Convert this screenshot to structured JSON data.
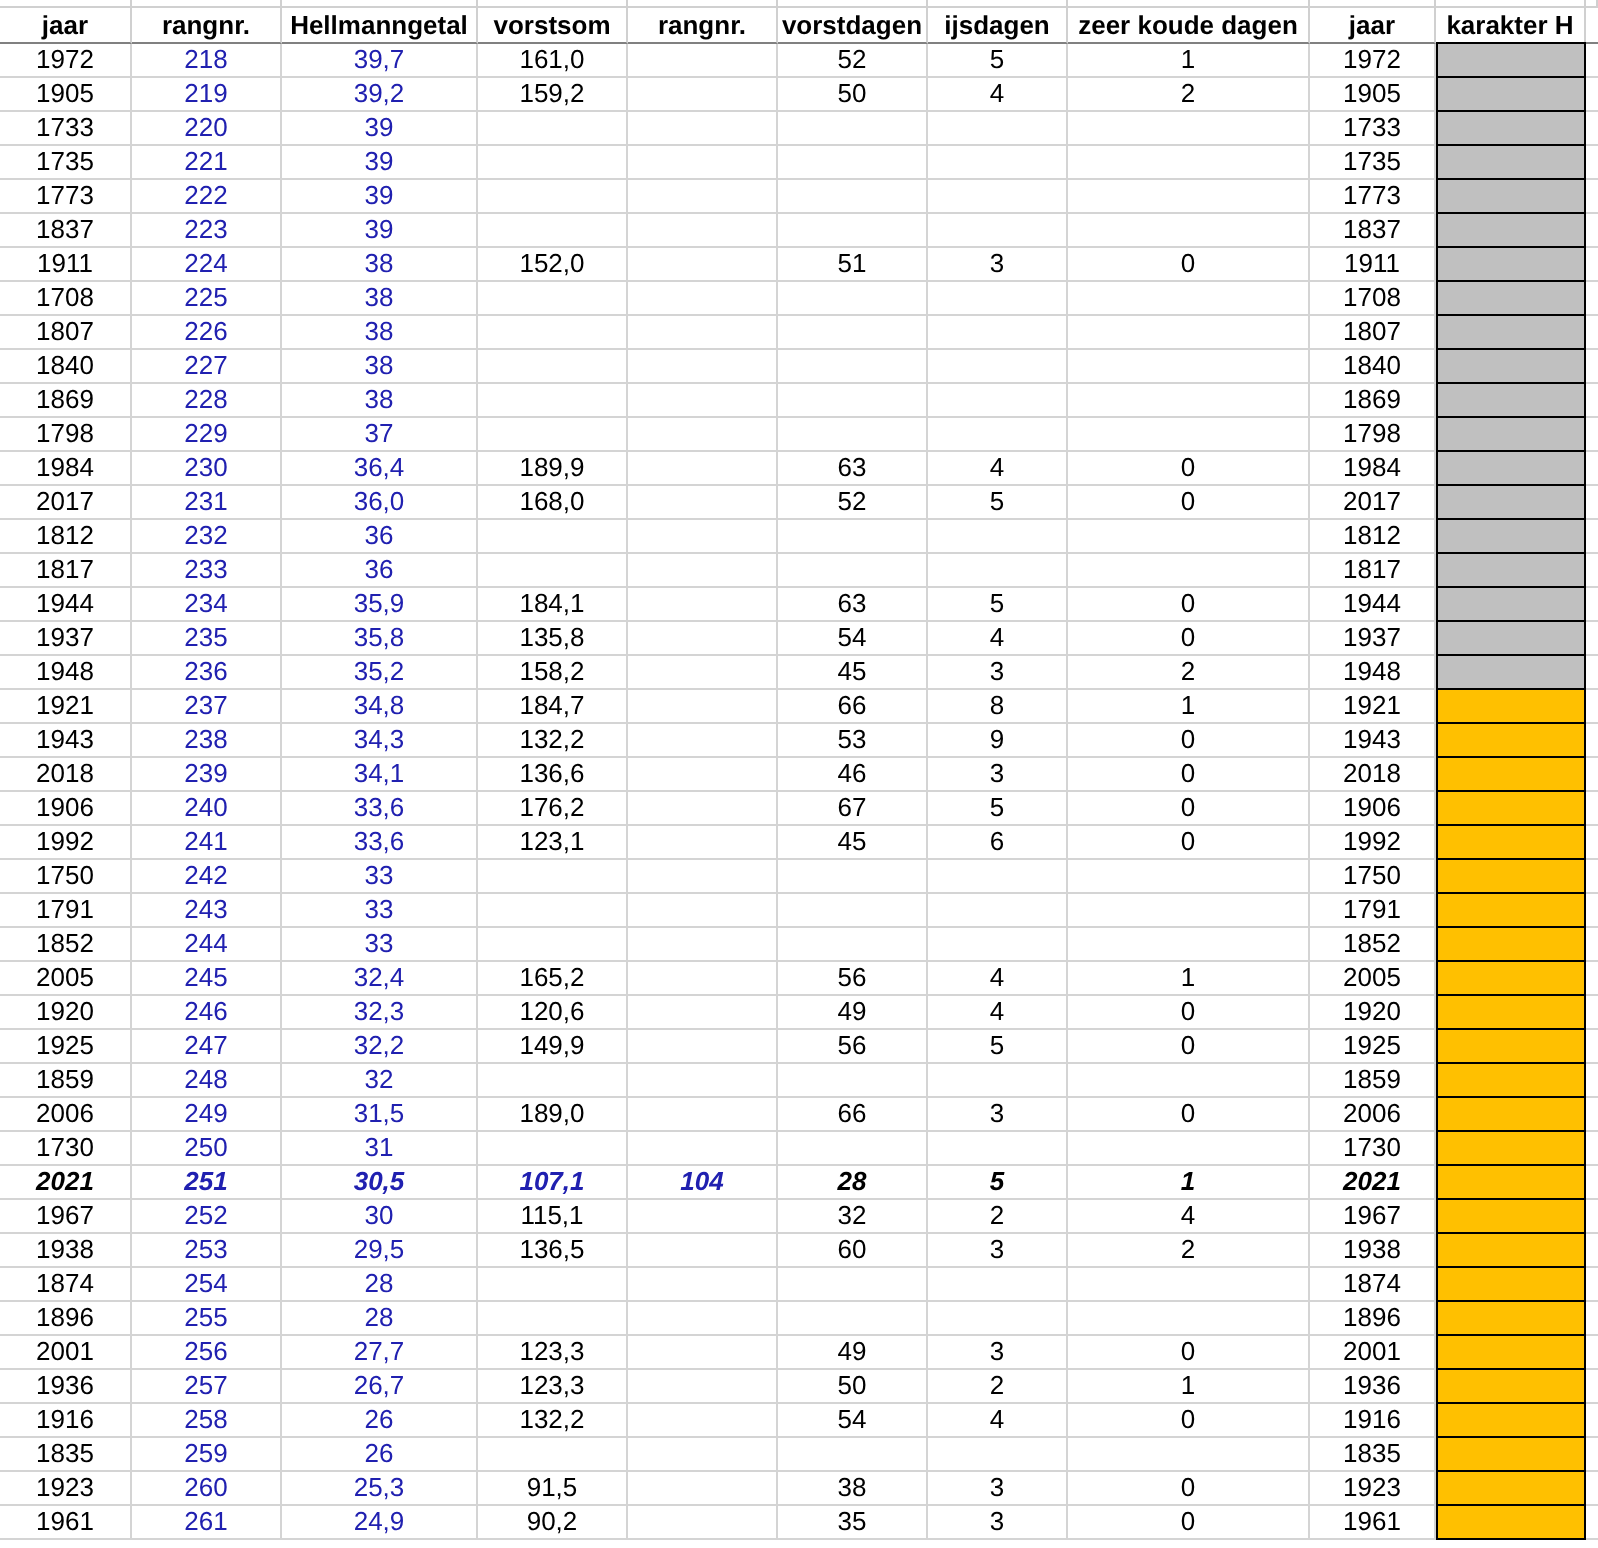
{
  "table": {
    "columns": [
      "jaar",
      "rangnr.",
      "Hellmanngetal",
      "vorstsom",
      "rangnr.",
      "vorstdagen",
      "ijsdagen",
      "zeer koude dagen",
      "jaar",
      "karakter H"
    ],
    "rows": [
      {
        "jaar": "1972",
        "rangnr": "218",
        "hellmann": "39,7",
        "vorstsom": "161,0",
        "vorstdagen": "52",
        "ijsdagen": "5",
        "zeer_koude_dagen": "1",
        "jaar_2": "1972",
        "color": "#c0c0c0",
        "highlighted": false
      },
      {
        "jaar": "1905",
        "rangnr": "219",
        "hellmann": "39,2",
        "vorstsom": "159,2",
        "vorstdagen": "50",
        "ijsdagen": "4",
        "zeer_koude_dagen": "2",
        "jaar_2": "1905",
        "color": "#c0c0c0",
        "highlighted": false
      },
      {
        "jaar": "1733",
        "rangnr": "220",
        "hellmann": "39",
        "jaar_2": "1733",
        "color": "#c0c0c0",
        "highlighted": false
      },
      {
        "jaar": "1735",
        "rangnr": "221",
        "hellmann": "39",
        "jaar_2": "1735",
        "color": "#c0c0c0",
        "highlighted": false
      },
      {
        "jaar": "1773",
        "rangnr": "222",
        "hellmann": "39",
        "jaar_2": "1773",
        "color": "#c0c0c0",
        "highlighted": false
      },
      {
        "jaar": "1837",
        "rangnr": "223",
        "hellmann": "39",
        "jaar_2": "1837",
        "color": "#c0c0c0",
        "highlighted": false
      },
      {
        "jaar": "1911",
        "rangnr": "224",
        "hellmann": "38",
        "vorstsom": "152,0",
        "vorstdagen": "51",
        "ijsdagen": "3",
        "zeer_koude_dagen": "0",
        "jaar_2": "1911",
        "color": "#c0c0c0",
        "highlighted": false
      },
      {
        "jaar": "1708",
        "rangnr": "225",
        "hellmann": "38",
        "jaar_2": "1708",
        "color": "#c0c0c0",
        "highlighted": false
      },
      {
        "jaar": "1807",
        "rangnr": "226",
        "hellmann": "38",
        "jaar_2": "1807",
        "color": "#c0c0c0",
        "highlighted": false
      },
      {
        "jaar": "1840",
        "rangnr": "227",
        "hellmann": "38",
        "jaar_2": "1840",
        "color": "#c0c0c0",
        "highlighted": false
      },
      {
        "jaar": "1869",
        "rangnr": "228",
        "hellmann": "38",
        "jaar_2": "1869",
        "color": "#c0c0c0",
        "highlighted": false
      },
      {
        "jaar": "1798",
        "rangnr": "229",
        "hellmann": "37",
        "jaar_2": "1798",
        "color": "#c0c0c0",
        "highlighted": false
      },
      {
        "jaar": "1984",
        "rangnr": "230",
        "hellmann": "36,4",
        "vorstsom": "189,9",
        "vorstdagen": "63",
        "ijsdagen": "4",
        "zeer_koude_dagen": "0",
        "jaar_2": "1984",
        "color": "#c0c0c0",
        "highlighted": false
      },
      {
        "jaar": "2017",
        "rangnr": "231",
        "hellmann": "36,0",
        "vorstsom": "168,0",
        "vorstdagen": "52",
        "ijsdagen": "5",
        "zeer_koude_dagen": "0",
        "jaar_2": "2017",
        "color": "#c0c0c0",
        "highlighted": false
      },
      {
        "jaar": "1812",
        "rangnr": "232",
        "hellmann": "36",
        "jaar_2": "1812",
        "color": "#c0c0c0",
        "highlighted": false
      },
      {
        "jaar": "1817",
        "rangnr": "233",
        "hellmann": "36",
        "jaar_2": "1817",
        "color": "#c0c0c0",
        "highlighted": false
      },
      {
        "jaar": "1944",
        "rangnr": "234",
        "hellmann": "35,9",
        "vorstsom": "184,1",
        "vorstdagen": "63",
        "ijsdagen": "5",
        "zeer_koude_dagen": "0",
        "jaar_2": "1944",
        "color": "#c0c0c0",
        "highlighted": false
      },
      {
        "jaar": "1937",
        "rangnr": "235",
        "hellmann": "35,8",
        "vorstsom": "135,8",
        "vorstdagen": "54",
        "ijsdagen": "4",
        "zeer_koude_dagen": "0",
        "jaar_2": "1937",
        "color": "#c0c0c0",
        "highlighted": false
      },
      {
        "jaar": "1948",
        "rangnr": "236",
        "hellmann": "35,2",
        "vorstsom": "158,2",
        "vorstdagen": "45",
        "ijsdagen": "3",
        "zeer_koude_dagen": "2",
        "jaar_2": "1948",
        "color": "#c0c0c0",
        "highlighted": false
      },
      {
        "jaar": "1921",
        "rangnr": "237",
        "hellmann": "34,8",
        "vorstsom": "184,7",
        "vorstdagen": "66",
        "ijsdagen": "8",
        "zeer_koude_dagen": "1",
        "jaar_2": "1921",
        "color": "#ffc000",
        "highlighted": false
      },
      {
        "jaar": "1943",
        "rangnr": "238",
        "hellmann": "34,3",
        "vorstsom": "132,2",
        "vorstdagen": "53",
        "ijsdagen": "9",
        "zeer_koude_dagen": "0",
        "jaar_2": "1943",
        "color": "#ffc000",
        "highlighted": false
      },
      {
        "jaar": "2018",
        "rangnr": "239",
        "hellmann": "34,1",
        "vorstsom": "136,6",
        "vorstdagen": "46",
        "ijsdagen": "3",
        "zeer_koude_dagen": "0",
        "jaar_2": "2018",
        "color": "#ffc000",
        "highlighted": false
      },
      {
        "jaar": "1906",
        "rangnr": "240",
        "hellmann": "33,6",
        "vorstsom": "176,2",
        "vorstdagen": "67",
        "ijsdagen": "5",
        "zeer_koude_dagen": "0",
        "jaar_2": "1906",
        "color": "#ffc000",
        "highlighted": false
      },
      {
        "jaar": "1992",
        "rangnr": "241",
        "hellmann": "33,6",
        "vorstsom": "123,1",
        "vorstdagen": "45",
        "ijsdagen": "6",
        "zeer_koude_dagen": "0",
        "jaar_2": "1992",
        "color": "#ffc000",
        "highlighted": false
      },
      {
        "jaar": "1750",
        "rangnr": "242",
        "hellmann": "33",
        "jaar_2": "1750",
        "color": "#ffc000",
        "highlighted": false
      },
      {
        "jaar": "1791",
        "rangnr": "243",
        "hellmann": "33",
        "jaar_2": "1791",
        "color": "#ffc000",
        "highlighted": false
      },
      {
        "jaar": "1852",
        "rangnr": "244",
        "hellmann": "33",
        "jaar_2": "1852",
        "color": "#ffc000",
        "highlighted": false
      },
      {
        "jaar": "2005",
        "rangnr": "245",
        "hellmann": "32,4",
        "vorstsom": "165,2",
        "vorstdagen": "56",
        "ijsdagen": "4",
        "zeer_koude_dagen": "1",
        "jaar_2": "2005",
        "color": "#ffc000",
        "highlighted": false
      },
      {
        "jaar": "1920",
        "rangnr": "246",
        "hellmann": "32,3",
        "vorstsom": "120,6",
        "vorstdagen": "49",
        "ijsdagen": "4",
        "zeer_koude_dagen": "0",
        "jaar_2": "1920",
        "color": "#ffc000",
        "highlighted": false
      },
      {
        "jaar": "1925",
        "rangnr": "247",
        "hellmann": "32,2",
        "vorstsom": "149,9",
        "vorstdagen": "56",
        "ijsdagen": "5",
        "zeer_koude_dagen": "0",
        "jaar_2": "1925",
        "color": "#ffc000",
        "highlighted": false
      },
      {
        "jaar": "1859",
        "rangnr": "248",
        "hellmann": "32",
        "jaar_2": "1859",
        "color": "#ffc000",
        "highlighted": false
      },
      {
        "jaar": "2006",
        "rangnr": "249",
        "hellmann": "31,5",
        "vorstsom": "189,0",
        "vorstdagen": "66",
        "ijsdagen": "3",
        "zeer_koude_dagen": "0",
        "jaar_2": "2006",
        "color": "#ffc000",
        "highlighted": false
      },
      {
        "jaar": "1730",
        "rangnr": "250",
        "hellmann": "31",
        "jaar_2": "1730",
        "color": "#ffc000",
        "highlighted": false
      },
      {
        "jaar": "2021",
        "rangnr": "251",
        "hellmann": "30,5",
        "vorstsom": "107,1",
        "rangnr_2": "104",
        "vorstdagen": "28",
        "ijsdagen": "5",
        "zeer_koude_dagen": "1",
        "jaar_2": "2021",
        "color": "#ffc000",
        "highlighted": true
      },
      {
        "jaar": "1967",
        "rangnr": "252",
        "hellmann": "30",
        "vorstsom": "115,1",
        "vorstdagen": "32",
        "ijsdagen": "2",
        "zeer_koude_dagen": "4",
        "jaar_2": "1967",
        "color": "#ffc000",
        "highlighted": false
      },
      {
        "jaar": "1938",
        "rangnr": "253",
        "hellmann": "29,5",
        "vorstsom": "136,5",
        "vorstdagen": "60",
        "ijsdagen": "3",
        "zeer_koude_dagen": "2",
        "jaar_2": "1938",
        "color": "#ffc000",
        "highlighted": false
      },
      {
        "jaar": "1874",
        "rangnr": "254",
        "hellmann": "28",
        "jaar_2": "1874",
        "color": "#ffc000",
        "highlighted": false
      },
      {
        "jaar": "1896",
        "rangnr": "255",
        "hellmann": "28",
        "jaar_2": "1896",
        "color": "#ffc000",
        "highlighted": false
      },
      {
        "jaar": "2001",
        "rangnr": "256",
        "hellmann": "27,7",
        "vorstsom": "123,3",
        "vorstdagen": "49",
        "ijsdagen": "3",
        "zeer_koude_dagen": "0",
        "jaar_2": "2001",
        "color": "#ffc000",
        "highlighted": false
      },
      {
        "jaar": "1936",
        "rangnr": "257",
        "hellmann": "26,7",
        "vorstsom": "123,3",
        "vorstdagen": "50",
        "ijsdagen": "2",
        "zeer_koude_dagen": "1",
        "jaar_2": "1936",
        "color": "#ffc000",
        "highlighted": false
      },
      {
        "jaar": "1916",
        "rangnr": "258",
        "hellmann": "26",
        "vorstsom": "132,2",
        "vorstdagen": "54",
        "ijsdagen": "4",
        "zeer_koude_dagen": "0",
        "jaar_2": "1916",
        "color": "#ffc000",
        "highlighted": false
      },
      {
        "jaar": "1835",
        "rangnr": "259",
        "hellmann": "26",
        "jaar_2": "1835",
        "color": "#ffc000",
        "highlighted": false
      },
      {
        "jaar": "1923",
        "rangnr": "260",
        "hellmann": "25,3",
        "vorstsom": "91,5",
        "vorstdagen": "38",
        "ijsdagen": "3",
        "zeer_koude_dagen": "0",
        "jaar_2": "1923",
        "color": "#ffc000",
        "highlighted": false
      },
      {
        "jaar": "1961",
        "rangnr": "261",
        "hellmann": "24,9",
        "vorstsom": "90,2",
        "vorstdagen": "35",
        "ijsdagen": "3",
        "zeer_koude_dagen": "0",
        "jaar_2": "1961",
        "color": "#ffc000",
        "highlighted": false
      }
    ]
  }
}
